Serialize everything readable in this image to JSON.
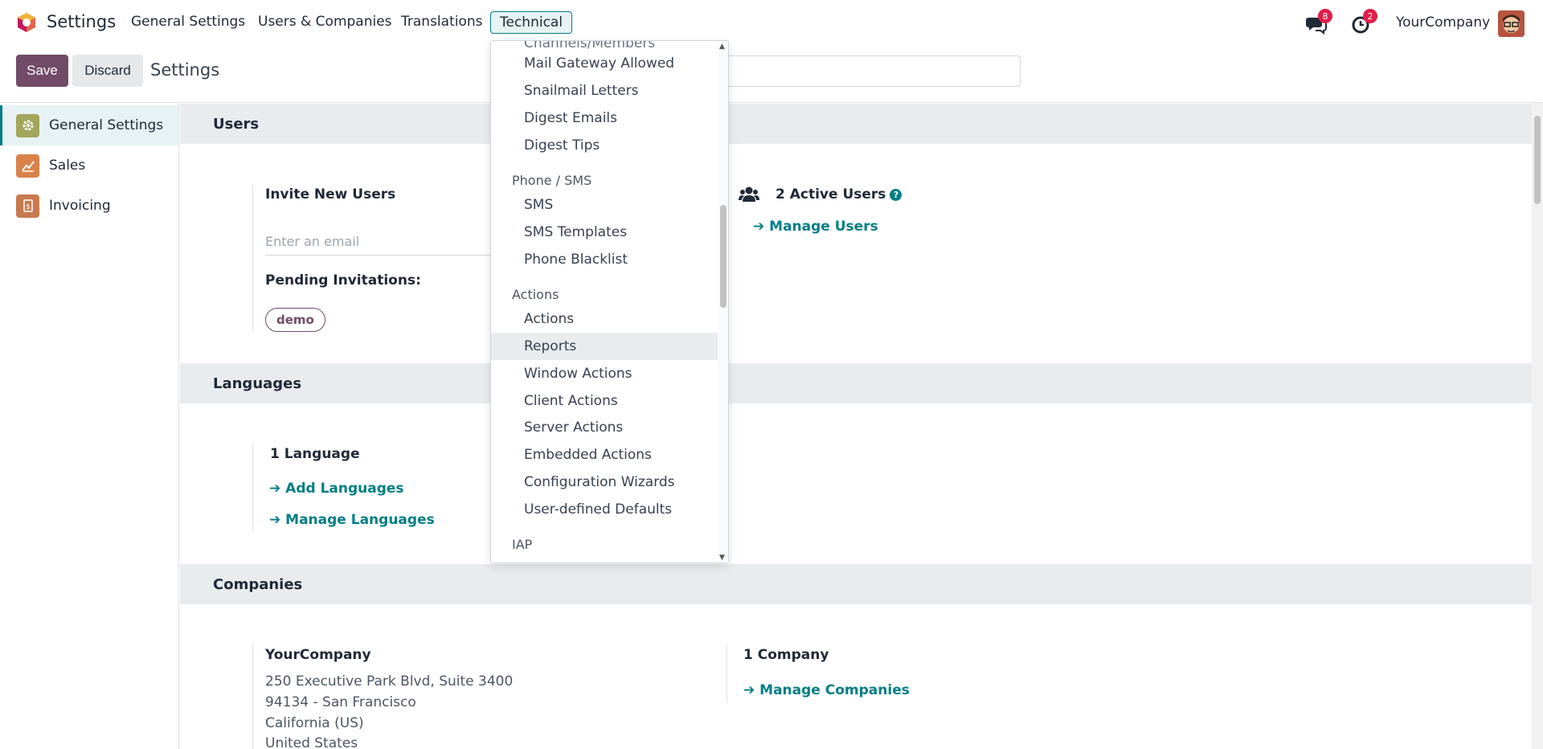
{
  "navbar": {
    "app_title": "Settings",
    "menu": [
      "General Settings",
      "Users & Companies",
      "Translations",
      "Technical"
    ],
    "active_menu": "Technical",
    "messages_badge": "8",
    "activities_badge": "2",
    "company": "YourCompany"
  },
  "control_panel": {
    "save_label": "Save",
    "discard_label": "Discard",
    "breadcrumb": "Settings"
  },
  "sidebar": {
    "items": [
      {
        "label": "General Settings",
        "icon": "gear-icon",
        "color": "#a3a55a"
      },
      {
        "label": "Sales",
        "icon": "chart-icon",
        "color": "#d9824a"
      },
      {
        "label": "Invoicing",
        "icon": "invoice-icon",
        "color": "#c77a4e"
      }
    ]
  },
  "users_section": {
    "title": "Users",
    "invite_label": "Invite New Users",
    "email_placeholder": "Enter an email",
    "pending_label": "Pending Invitations:",
    "pending_tag": "demo",
    "active_users": "2 Active Users",
    "manage_users": "Manage Users"
  },
  "languages_section": {
    "title": "Languages",
    "count": "1 Language",
    "add_link": "Add Languages",
    "manage_link": "Manage Languages"
  },
  "companies_section": {
    "title": "Companies",
    "company_name": "YourCompany",
    "address_lines": [
      "250 Executive Park Blvd, Suite 3400",
      "94134 - San Francisco",
      "California (US)",
      "United States"
    ],
    "count": "1 Company",
    "manage_link": "Manage Companies"
  },
  "dropdown": {
    "partial_top": "Channels/Members",
    "email_items": [
      "Mail Gateway Allowed",
      "Snailmail Letters",
      "Digest Emails",
      "Digest Tips"
    ],
    "phone_header": "Phone / SMS",
    "phone_items": [
      "SMS",
      "SMS Templates",
      "Phone Blacklist"
    ],
    "actions_header": "Actions",
    "actions_items": [
      "Actions",
      "Reports",
      "Window Actions",
      "Client Actions",
      "Server Actions",
      "Embedded Actions",
      "Configuration Wizards",
      "User-defined Defaults"
    ],
    "hovered_item": "Reports",
    "iap_header": "IAP"
  },
  "colors": {
    "brand": "#714b67",
    "accent": "#017e84",
    "badge": "#e11d48"
  }
}
